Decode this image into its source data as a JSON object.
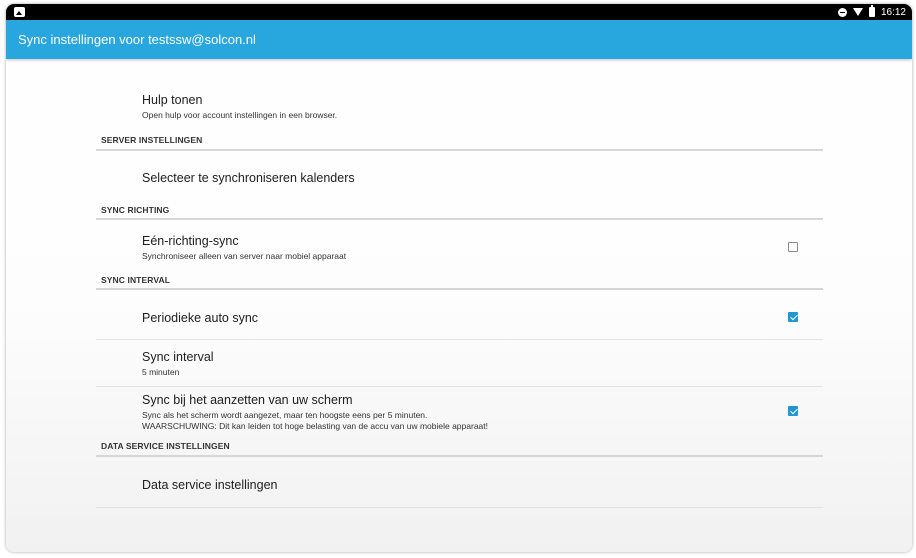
{
  "status_bar": {
    "time": "16:12",
    "icons": [
      "image-notification-icon",
      "do-not-disturb-icon",
      "wifi-icon",
      "battery-icon"
    ]
  },
  "toolbar": {
    "title": "Sync instellingen voor testssw@solcon.nl",
    "color": "#27a7de"
  },
  "items": {
    "help": {
      "title": "Hulp tonen",
      "summary": "Open hulp voor account instellingen in een browser."
    },
    "select_calendars": {
      "title": "Selecteer te synchroniseren kalenders"
    },
    "one_way_sync": {
      "title": "Eén-richting-sync",
      "summary": "Synchroniseer alleen van server naar mobiel apparaat",
      "checked": false
    },
    "periodic_sync": {
      "title": "Periodieke auto sync",
      "checked": true
    },
    "sync_interval": {
      "title": "Sync interval",
      "summary": "5 minuten"
    },
    "sync_screen_on": {
      "title": "Sync bij het aanzetten van uw scherm",
      "summary1": "Sync als het scherm wordt aangezet, maar ten hoogste eens per 5 minuten.",
      "summary2": "WAARSCHUWING: Dit kan leiden tot hoge belasting van de accu van uw mobiele apparaat!",
      "checked": true
    },
    "data_service": {
      "title": "Data service instellingen"
    }
  },
  "categories": {
    "server": "SERVER INSTELLINGEN",
    "sync_direction": "SYNC RICHTING",
    "sync_interval": "SYNC INTERVAL",
    "data_service": "DATA SERVICE INSTELLINGEN"
  },
  "accent": "#2196d3"
}
